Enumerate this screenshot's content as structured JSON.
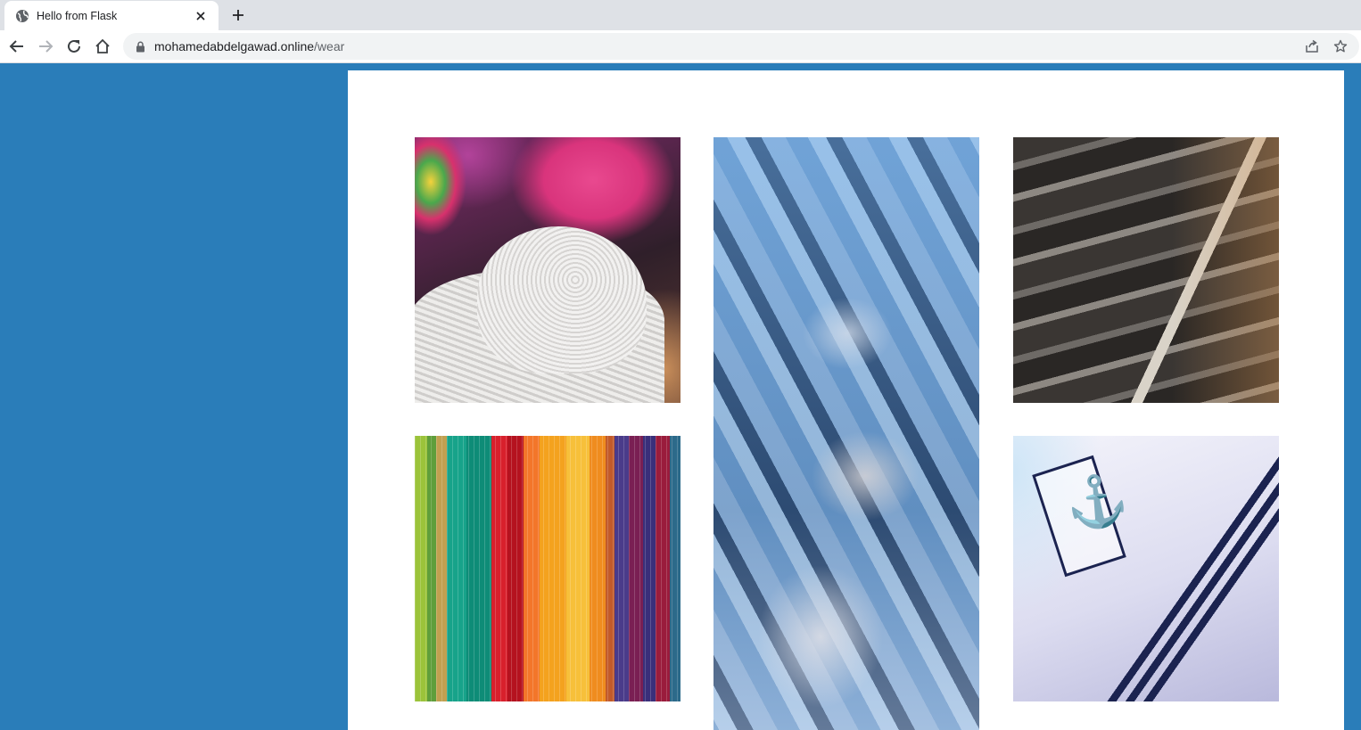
{
  "browser": {
    "tab": {
      "title": "Hello from Flask",
      "favicon": "globe-icon"
    },
    "new_tab_icon": "plus-icon",
    "toolbar": {
      "back_icon": "arrow-left-icon",
      "forward_icon": "arrow-right-icon",
      "reload_icon": "reload-icon",
      "home_icon": "home-icon",
      "share_icon": "share-icon",
      "bookmark_icon": "star-icon"
    },
    "address": {
      "host": "mohamedabdelgawad.online",
      "path": "/wear",
      "lock_icon": "lock-icon"
    }
  },
  "page": {
    "background_color": "#2a7db9",
    "panel_color": "#ffffff",
    "gallery": [
      {
        "subject": "hats"
      },
      {
        "subject": "blurred-hangers"
      },
      {
        "subject": "shoes"
      },
      {
        "subject": "colorful-fabrics"
      },
      {
        "subject": "sailor-shirt"
      }
    ]
  }
}
